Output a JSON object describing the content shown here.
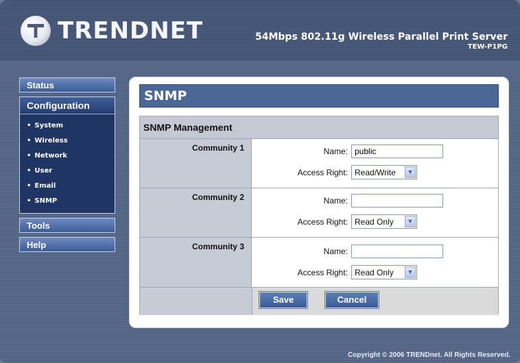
{
  "header": {
    "logo_text": "TRENDNET",
    "product_line": "54Mbps 802.11g Wireless Parallel Print Server",
    "model": "TEW-P1PG"
  },
  "sidebar": {
    "status_label": "Status",
    "configuration_label": "Configuration",
    "config_items": [
      "System",
      "Wireless",
      "Network",
      "User",
      "Email",
      "SNMP"
    ],
    "tools_label": "Tools",
    "help_label": "Help"
  },
  "main": {
    "title": "SNMP",
    "section_header": "SNMP Management",
    "communities": [
      {
        "label": "Community 1",
        "name_label": "Name:",
        "name_value": "public",
        "access_label": "Access Right:",
        "access_value": "Read/Write"
      },
      {
        "label": "Community 2",
        "name_label": "Name:",
        "name_value": "",
        "access_label": "Access Right:",
        "access_value": "Read Only"
      },
      {
        "label": "Community 3",
        "name_label": "Name:",
        "name_value": "",
        "access_label": "Access Right:",
        "access_value": "Read Only"
      }
    ],
    "save_label": "Save",
    "cancel_label": "Cancel"
  },
  "footer": {
    "copyright": "Copyright © 2006 TRENDnet. All Rights Reserved."
  },
  "colors": {
    "title_bar": "#4a6796",
    "sidebar_section": "#1f3563",
    "row_label_bg": "#c7cbd5"
  },
  "icons": {
    "logo": "trendnet-logo-icon",
    "dropdown": "chevron-down-icon"
  }
}
